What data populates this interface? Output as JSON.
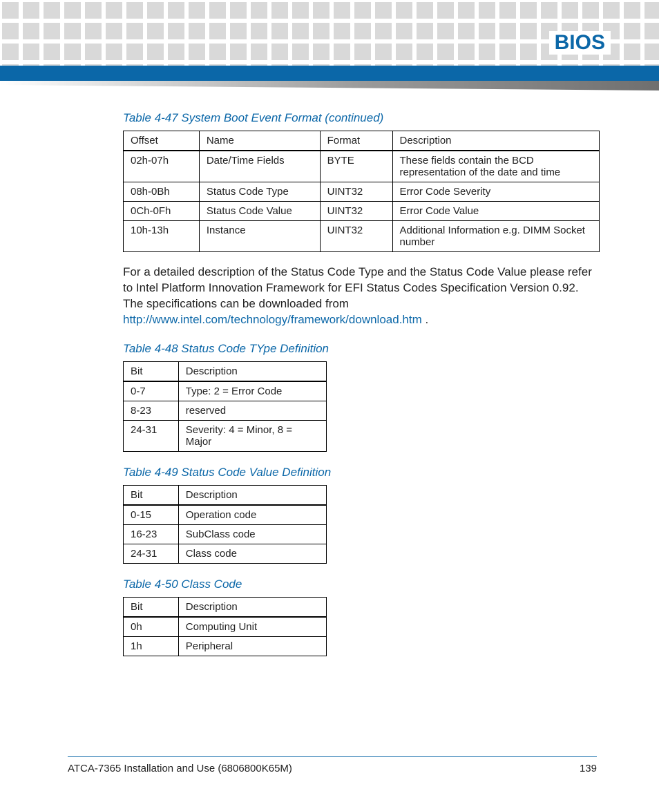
{
  "header": {
    "title": "BIOS"
  },
  "table47": {
    "caption": "Table 4-47 System Boot Event Format (continued)",
    "headers": {
      "c1": "Offset",
      "c2": "Name",
      "c3": "Format",
      "c4": "Description"
    },
    "rows": [
      {
        "c1": "02h-07h",
        "c2": "Date/Time Fields",
        "c3": "BYTE",
        "c4": "These fields contain the BCD representation of the date and time"
      },
      {
        "c1": "08h-0Bh",
        "c2": "Status Code Type",
        "c3": "UINT32",
        "c4": "Error Code Severity"
      },
      {
        "c1": "0Ch-0Fh",
        "c2": "Status Code Value",
        "c3": "UINT32",
        "c4": "Error Code Value"
      },
      {
        "c1": "10h-13h",
        "c2": "Instance",
        "c3": "UINT32",
        "c4": "Additional Information e.g. DIMM Socket number"
      }
    ]
  },
  "paragraph": {
    "text_before_link": "For a detailed description of the Status Code Type and the Status Code Value please refer to Intel Platform Innovation Framework for EFI Status Codes Specification Version 0.92. The specifications can be downloaded from ",
    "link_text": "http://www.intel.com/technology/framework/download.htm",
    "text_after_link": " ."
  },
  "table48": {
    "caption": "Table 4-48 Status Code TYpe Definition",
    "headers": {
      "c1": "Bit",
      "c2": "Description"
    },
    "rows": [
      {
        "c1": "0-7",
        "c2": "Type: 2 = Error Code"
      },
      {
        "c1": "8-23",
        "c2": "reserved"
      },
      {
        "c1": "24-31",
        "c2": "Severity: 4 = Minor, 8 = Major"
      }
    ]
  },
  "table49": {
    "caption": "Table 4-49 Status Code Value Definition",
    "headers": {
      "c1": "Bit",
      "c2": "Description"
    },
    "rows": [
      {
        "c1": "0-15",
        "c2": "Operation code"
      },
      {
        "c1": "16-23",
        "c2": "SubClass code"
      },
      {
        "c1": "24-31",
        "c2": "Class code"
      }
    ]
  },
  "table50": {
    "caption": "Table 4-50 Class Code",
    "headers": {
      "c1": "Bit",
      "c2": "Description"
    },
    "rows": [
      {
        "c1": "0h",
        "c2": "Computing Unit"
      },
      {
        "c1": "1h",
        "c2": "Peripheral"
      }
    ]
  },
  "footer": {
    "doc_title": "ATCA-7365 Installation and Use (6806800K65M)",
    "page_number": "139"
  }
}
